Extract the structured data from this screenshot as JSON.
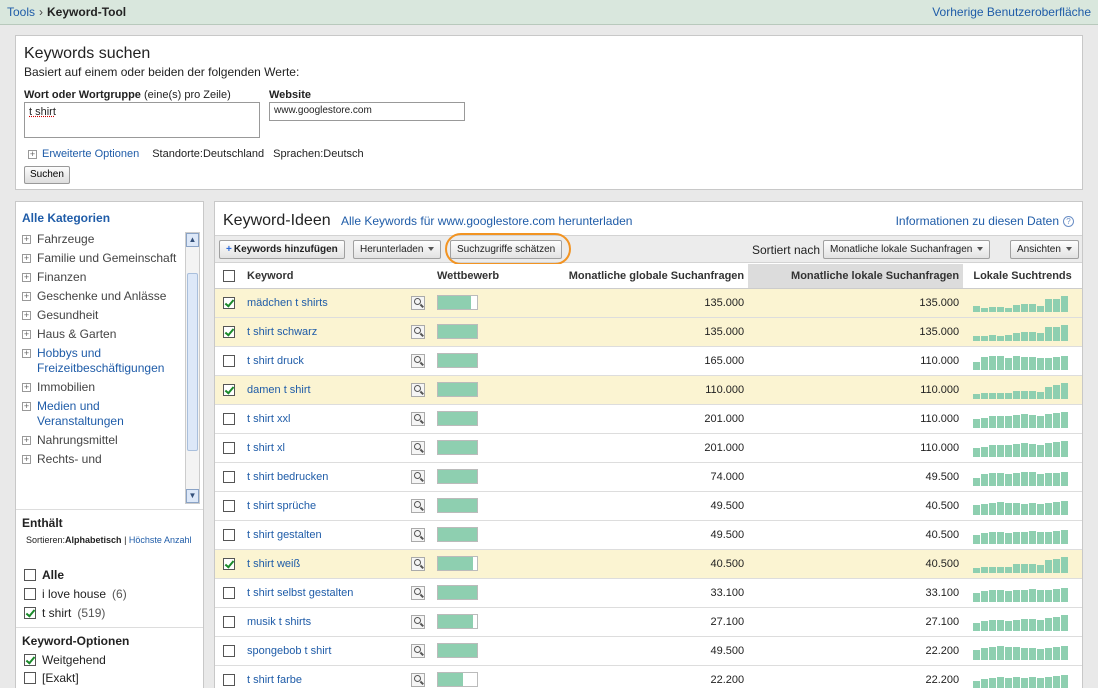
{
  "topbar": {
    "crumb_tools": "Tools",
    "sep": "›",
    "crumb_current": "Keyword-Tool",
    "prev_ui": "Vorherige Benutzeroberfläche"
  },
  "search": {
    "title": "Keywords suchen",
    "subtitle": "Basiert auf einem oder beiden der folgenden Werte:",
    "kw_label": "Wort oder Wortgruppe",
    "kw_hint": "(eine(s) pro Zeile)",
    "kw_value": "t shirt",
    "web_label": "Website",
    "web_value": "www.googlestore.com",
    "adv_label": "Erweiterte Optionen",
    "locations": "Standorte:Deutschland",
    "languages": "Sprachen:Deutsch",
    "button": "Suchen"
  },
  "sidebar": {
    "title": "Alle Kategorien",
    "categories": [
      {
        "label": "Fahrzeuge",
        "link": false
      },
      {
        "label": "Familie und Gemeinschaft",
        "link": false
      },
      {
        "label": "Finanzen",
        "link": false
      },
      {
        "label": "Geschenke und Anlässe",
        "link": false
      },
      {
        "label": "Gesundheit",
        "link": false
      },
      {
        "label": "Haus & Garten",
        "link": false
      },
      {
        "label": "Hobbys und Freizeitbeschäftigungen",
        "link": true
      },
      {
        "label": "Immobilien",
        "link": false
      },
      {
        "label": "Medien und Veranstaltungen",
        "link": true
      },
      {
        "label": "Nahrungsmittel",
        "link": false
      },
      {
        "label": "Rechts- und",
        "link": false
      }
    ],
    "contains_title": "Enthält",
    "sort_prefix": "Sortieren:",
    "sort_alpha": "Alphabetisch",
    "sort_sep": "|",
    "sort_count": "Höchste Anzahl",
    "filter_all": "Alle",
    "filter_1": "i love house",
    "filter_1_count": "(6)",
    "filter_2": "t shirt",
    "filter_2_count": "(519)",
    "options_title": "Keyword-Optionen",
    "opt_1": "Weitgehend",
    "opt_2": "[Exakt]"
  },
  "main": {
    "title": "Keyword-Ideen",
    "download_all": "Alle Keywords für www.googlestore.com herunterladen",
    "info": "Informationen zu diesen Daten",
    "help": "?",
    "toolbar": {
      "add": "Keywords hinzufügen",
      "download": "Herunterladen",
      "estimate": "Suchzugriffe schätzen",
      "sort_label": "Sortiert nach",
      "sort_value": "Monatliche lokale Suchanfragen",
      "views": "Ansichten"
    },
    "columns": {
      "keyword": "Keyword",
      "competition": "Wettbewerb",
      "global": "Monatliche globale Suchanfragen",
      "local": "Monatliche lokale Suchanfragen",
      "trends": "Lokale Suchtrends"
    }
  },
  "colors": {
    "accent": "#1f5ca8",
    "highlight_row": "#fbf4d2",
    "bar": "#8ecfb0",
    "oval": "#f29423"
  },
  "rows": [
    {
      "kw": "mädchen t shirts",
      "sel": true,
      "comp": 0.85,
      "global": "135.000",
      "local": "135.000",
      "trend": [
        6,
        4,
        5,
        5,
        4,
        7,
        8,
        8,
        6,
        13,
        13,
        16
      ]
    },
    {
      "kw": "t shirt schwarz",
      "sel": true,
      "comp": 1.0,
      "global": "135.000",
      "local": "135.000",
      "trend": [
        5,
        5,
        6,
        5,
        6,
        8,
        9,
        9,
        8,
        14,
        14,
        16
      ]
    },
    {
      "kw": "t shirt druck",
      "sel": false,
      "comp": 1.0,
      "global": "165.000",
      "local": "110.000",
      "trend": [
        8,
        13,
        14,
        14,
        12,
        14,
        13,
        13,
        12,
        12,
        13,
        14
      ]
    },
    {
      "kw": "damen t shirt",
      "sel": true,
      "comp": 1.0,
      "global": "110.000",
      "local": "110.000",
      "trend": [
        5,
        6,
        6,
        6,
        6,
        8,
        8,
        8,
        7,
        12,
        14,
        16
      ]
    },
    {
      "kw": "t shirt xxl",
      "sel": false,
      "comp": 1.0,
      "global": "201.000",
      "local": "110.000",
      "trend": [
        9,
        10,
        12,
        12,
        12,
        13,
        14,
        13,
        12,
        14,
        15,
        16
      ]
    },
    {
      "kw": "t shirt xl",
      "sel": false,
      "comp": 1.0,
      "global": "201.000",
      "local": "110.000",
      "trend": [
        9,
        10,
        12,
        12,
        12,
        13,
        14,
        13,
        12,
        14,
        15,
        16
      ]
    },
    {
      "kw": "t shirt bedrucken",
      "sel": false,
      "comp": 1.0,
      "global": "74.000",
      "local": "49.500",
      "trend": [
        8,
        12,
        13,
        13,
        12,
        13,
        14,
        14,
        12,
        13,
        13,
        14
      ]
    },
    {
      "kw": "t shirt sprüche",
      "sel": false,
      "comp": 1.0,
      "global": "49.500",
      "local": "40.500",
      "trend": [
        10,
        11,
        12,
        13,
        12,
        12,
        11,
        12,
        11,
        12,
        13,
        14
      ]
    },
    {
      "kw": "t shirt gestalten",
      "sel": false,
      "comp": 1.0,
      "global": "49.500",
      "local": "40.500",
      "trend": [
        9,
        11,
        12,
        12,
        11,
        12,
        12,
        13,
        12,
        12,
        13,
        14
      ]
    },
    {
      "kw": "t shirt weiß",
      "sel": true,
      "comp": 0.9,
      "global": "40.500",
      "local": "40.500",
      "trend": [
        5,
        6,
        6,
        6,
        6,
        9,
        9,
        9,
        8,
        13,
        14,
        16
      ]
    },
    {
      "kw": "t shirt selbst gestalten",
      "sel": false,
      "comp": 1.0,
      "global": "33.100",
      "local": "33.100",
      "trend": [
        9,
        11,
        12,
        12,
        11,
        12,
        12,
        13,
        12,
        12,
        13,
        14
      ]
    },
    {
      "kw": "musik t shirts",
      "sel": false,
      "comp": 0.9,
      "global": "27.100",
      "local": "27.100",
      "trend": [
        8,
        10,
        11,
        11,
        10,
        11,
        12,
        12,
        11,
        13,
        14,
        16
      ]
    },
    {
      "kw": "spongebob t shirt",
      "sel": false,
      "comp": 1.0,
      "global": "49.500",
      "local": "22.200",
      "trend": [
        10,
        12,
        13,
        14,
        13,
        13,
        12,
        12,
        11,
        12,
        13,
        14
      ]
    },
    {
      "kw": "t shirt farbe",
      "sel": false,
      "comp": 0.65,
      "global": "22.200",
      "local": "22.200",
      "trend": [
        8,
        10,
        11,
        12,
        11,
        12,
        11,
        12,
        11,
        12,
        13,
        14
      ]
    }
  ]
}
